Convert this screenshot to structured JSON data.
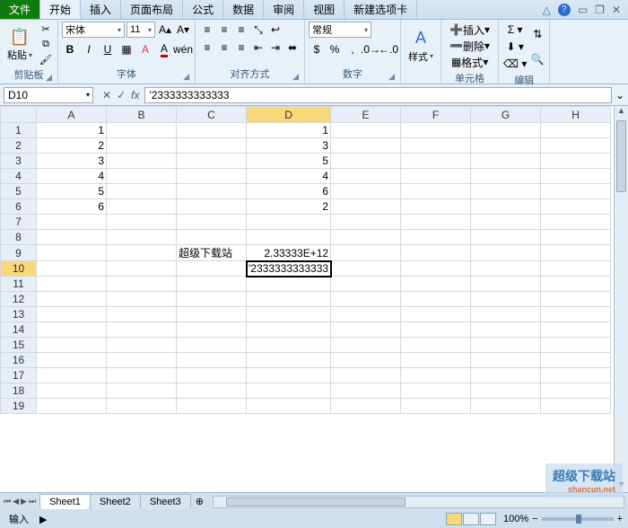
{
  "tabs": {
    "file": "文件",
    "home": "开始",
    "insert": "插入",
    "layout": "页面布局",
    "formulas": "公式",
    "data": "数据",
    "review": "审阅",
    "view": "视图",
    "addin": "新建选项卡"
  },
  "ribbon": {
    "clipboard": {
      "paste": "粘贴",
      "label": "剪贴板"
    },
    "font": {
      "name": "宋体",
      "size": "11",
      "label": "字体"
    },
    "align": {
      "label": "对齐方式"
    },
    "number": {
      "format": "常规",
      "label": "数字"
    },
    "styles": {
      "btn": "样式",
      "label": ""
    },
    "cells": {
      "insert": "插入",
      "delete": "删除",
      "format": "格式",
      "label": "单元格"
    },
    "editing": {
      "label": "编辑"
    }
  },
  "formula_bar": {
    "cell_ref": "D10",
    "cancel": "✕",
    "enter": "✓",
    "fx": "fx",
    "value": "'2333333333333"
  },
  "columns": [
    "A",
    "B",
    "C",
    "D",
    "E",
    "F",
    "G",
    "H"
  ],
  "active": {
    "row": 10,
    "col": "D"
  },
  "cells": {
    "A1": "1",
    "A2": "2",
    "A3": "3",
    "A4": "4",
    "A5": "5",
    "A6": "6",
    "D1": "1",
    "D2": "3",
    "D3": "5",
    "D4": "4",
    "D5": "6",
    "D6": "2",
    "C9": "超级下载站",
    "D9": "2.33333E+12",
    "D10": "'2333333333333"
  },
  "row_count": 19,
  "sheets": [
    "Sheet1",
    "Sheet2",
    "Sheet3"
  ],
  "status": {
    "mode": "输入",
    "zoom": "100%",
    "zoom_out": "−",
    "zoom_in": "+"
  },
  "watermark": {
    "main": "超级下载站",
    "sub": "shancun.net"
  },
  "chart_data": null
}
